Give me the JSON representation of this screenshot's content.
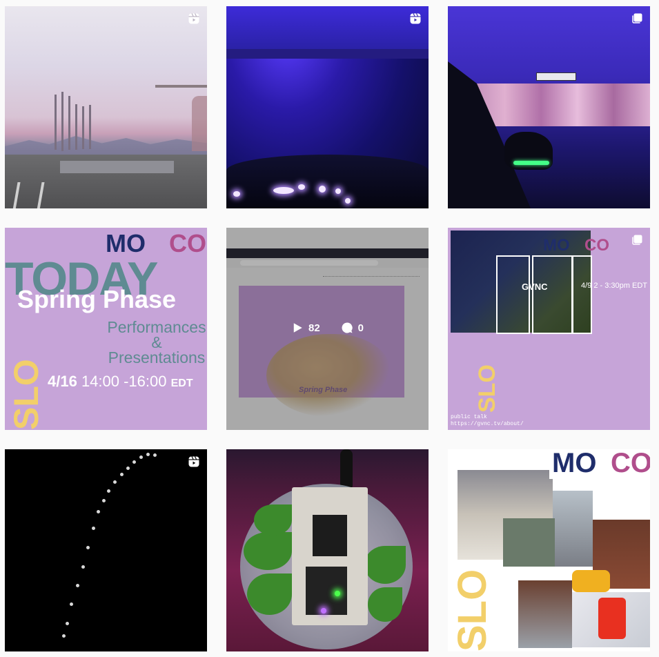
{
  "grid": {
    "posts": [
      {
        "id": "post-1",
        "badge": "reel"
      },
      {
        "id": "post-2",
        "badge": "reel"
      },
      {
        "id": "post-3",
        "badge": "carousel"
      },
      {
        "id": "post-4",
        "badge": "none",
        "poster": {
          "mo": "MO",
          "co": "CO",
          "today": "TODAY",
          "title": "Spring Phase",
          "line1": "Performances",
          "amp": "&",
          "line2": "Presentations",
          "date": "4/16",
          "time": " 14:00 -16:00 ",
          "tz": "EDT",
          "slo": "SLO"
        }
      },
      {
        "id": "post-5",
        "badge": "none",
        "caption": "Spring Phase",
        "hover": {
          "plays": "82",
          "comments": "0"
        }
      },
      {
        "id": "post-6",
        "badge": "carousel",
        "poster": {
          "mo": "MO",
          "co": "CO",
          "gvnc": "GVNC",
          "when": "4/9 2 - 3:30pm EDT",
          "talk1": "public talk",
          "talk2": "https://gvnc.tv/about/",
          "slo": "SLO"
        }
      },
      {
        "id": "post-7",
        "badge": "reel"
      },
      {
        "id": "post-8",
        "badge": "none"
      },
      {
        "id": "post-9",
        "badge": "none",
        "poster": {
          "mo": "MO",
          "co": "CO",
          "slo": "SLO"
        }
      }
    ]
  },
  "colors": {
    "background": "#fafafa",
    "lavender": "#c6a4d8",
    "navy": "#1f2d6b",
    "magenta": "#b04e8c",
    "yellow": "#f2cf6a",
    "teal": "#5f8b92"
  },
  "icons": {
    "reel": "reel-icon",
    "carousel": "carousel-icon",
    "play": "play-icon",
    "comment": "comment-icon"
  }
}
